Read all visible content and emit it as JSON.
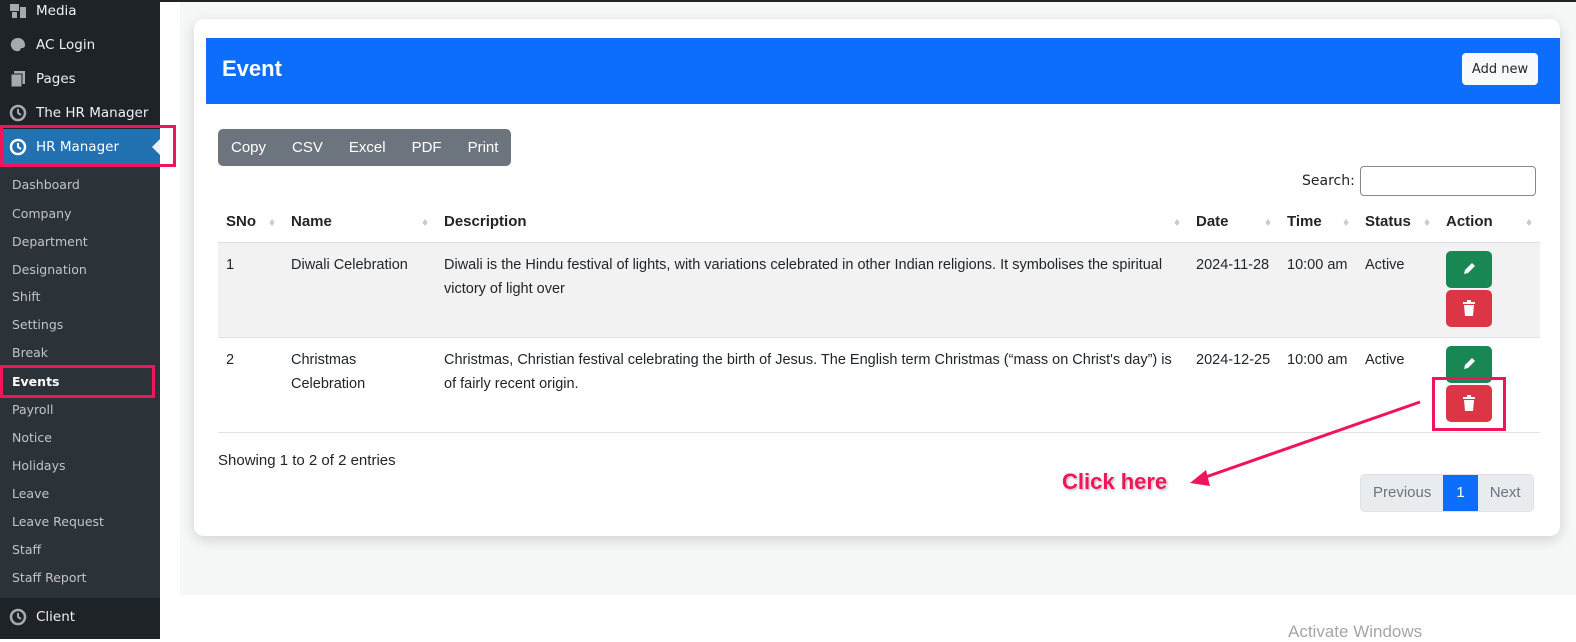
{
  "sidebar": {
    "top_items": [
      {
        "label": "Media",
        "icon": "media-icon"
      },
      {
        "label": "AC Login",
        "icon": "palette-icon"
      },
      {
        "label": "Pages",
        "icon": "pages-icon"
      },
      {
        "label": "The HR Manager",
        "icon": "clock-icon"
      },
      {
        "label": "HR Manager",
        "icon": "clock-icon",
        "current": true
      }
    ],
    "sub_items": [
      {
        "label": "Dashboard"
      },
      {
        "label": "Company"
      },
      {
        "label": "Department"
      },
      {
        "label": "Designation"
      },
      {
        "label": "Shift"
      },
      {
        "label": "Settings"
      },
      {
        "label": "Break"
      },
      {
        "label": "Events",
        "active": true
      },
      {
        "label": "Payroll"
      },
      {
        "label": "Notice"
      },
      {
        "label": "Holidays"
      },
      {
        "label": "Leave"
      },
      {
        "label": "Leave Request"
      },
      {
        "label": "Staff"
      },
      {
        "label": "Staff Report"
      }
    ],
    "bottom_item": {
      "label": "Client",
      "icon": "clock-icon"
    }
  },
  "card": {
    "title": "Event",
    "add_new_label": "Add new",
    "header_color": "#0d6efd"
  },
  "export_buttons": [
    "Copy",
    "CSV",
    "Excel",
    "PDF",
    "Print"
  ],
  "search": {
    "label": "Search:",
    "value": "",
    "placeholder": ""
  },
  "table": {
    "columns": [
      "SNo",
      "Name",
      "Description",
      "Date",
      "Time",
      "Status",
      "Action"
    ],
    "rows": [
      {
        "sno": "1",
        "name": "Diwali Celebration",
        "description": "Diwali is the Hindu festival of lights, with variations celebrated in other Indian religions. It symbolises the spiritual victory of light over",
        "date": "2024-11-28",
        "time": "10:00 am",
        "status": "Active"
      },
      {
        "sno": "2",
        "name": "Christmas Celebration",
        "description": "Christmas, Christian festival celebrating the birth of Jesus. The English term Christmas (“mass on Christ's day”) is of fairly recent origin.",
        "date": "2024-12-25",
        "time": "10:00 am",
        "status": "Active"
      }
    ]
  },
  "info_text": "Showing 1 to 2 of 2 entries",
  "pagination": {
    "previous": "Previous",
    "current": "1",
    "next": "Next"
  },
  "annotation": {
    "text": "Click here",
    "color": "#f0145a"
  },
  "watermark": "Activate Windows"
}
